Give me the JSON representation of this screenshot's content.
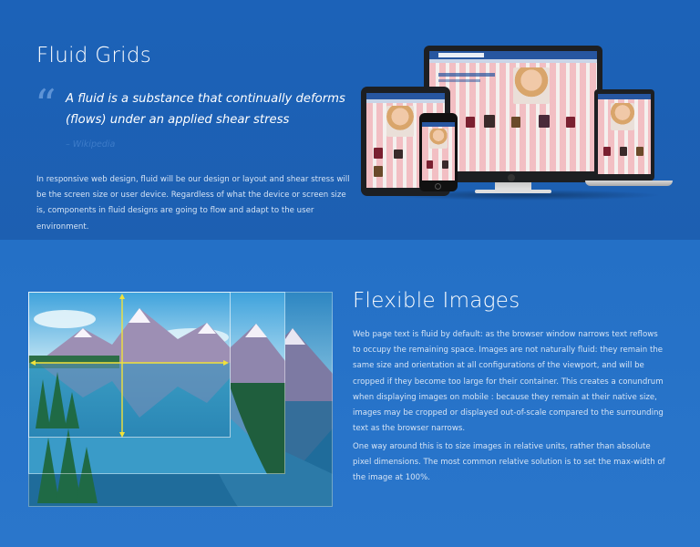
{
  "fluid": {
    "title": "Fluid Grids",
    "quote": "A fluid is a substance that continually deforms (flows) under an applied shear stress",
    "quote_source": "– Wikipedia",
    "body": "In responsive web design, fluid will be our design or layout and shear stress will be the screen size or user device. Regardless of what the device or screen size is, components in fluid designs are going to flow and adapt to the user environment."
  },
  "flexible": {
    "title": "Flexible Images",
    "body1": "Web page text is fluid by default: as the browser window narrows text reflows to occupy the remaining space. Images are not naturally fluid: they remain the same size and orientation at all configurations of the viewport, and will be cropped if they become too large for their container. This creates a conundrum when displaying images on mobile : because they remain at their native size, images may be cropped or displayed out-of-scale compared to the surrounding text as the browser narrows.",
    "body2": "One way around this is to size images in relative units, rather than absolute pixel dimensions. The most common relative solution is to set the max-width of the image at 100%."
  },
  "icons": {
    "quote": "quote-icon",
    "devices": "responsive-devices-illustration",
    "landscape": "landscape-illustration"
  },
  "colors": {
    "top_bg": "#1c62b8",
    "bottom_bg": "#2470c6",
    "quote_source": "#3d7bc8",
    "guide_lines": "#f2e23a"
  }
}
